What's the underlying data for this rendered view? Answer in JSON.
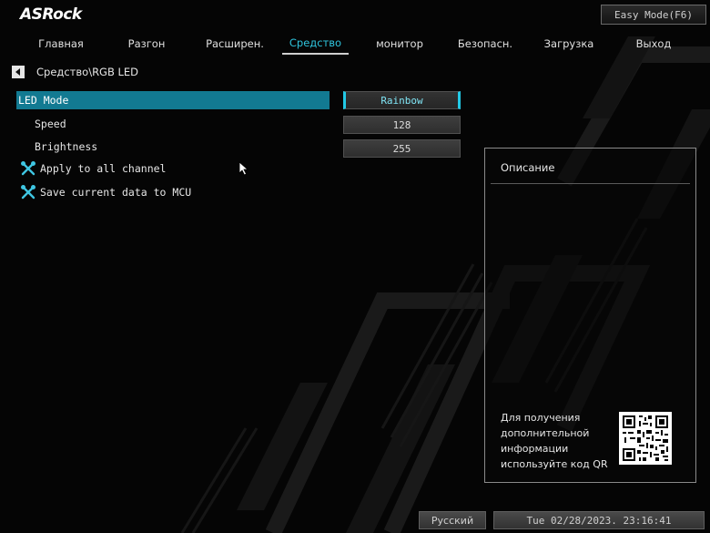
{
  "brand": {
    "logo": "ASRock"
  },
  "header": {
    "easy_mode_label": "Easy Mode(F6)"
  },
  "tabs": [
    {
      "label": "Главная"
    },
    {
      "label": "Разгон"
    },
    {
      "label": "Расширен."
    },
    {
      "label": "Средство",
      "active": true
    },
    {
      "label": "монитор"
    },
    {
      "label": "Безопасн."
    },
    {
      "label": "Загрузка"
    },
    {
      "label": "Выход"
    }
  ],
  "breadcrumb": "Средство\\RGB LED",
  "settings": [
    {
      "label": "LED Mode",
      "value": "Rainbow",
      "selected": true
    },
    {
      "label": "Speed",
      "value": "128"
    },
    {
      "label": "Brightness",
      "value": "255"
    }
  ],
  "actions": [
    {
      "label": "Apply to all channel",
      "icon": "tools-icon"
    },
    {
      "label": "Save current data to MCU",
      "icon": "tools-icon"
    }
  ],
  "description": {
    "title": "Описание",
    "note": "Для получения дополнительной информации используйте код QR"
  },
  "footer": {
    "language": "Русский",
    "datetime": "Tue 02/28/2023. 23:16:41"
  },
  "colors": {
    "accent": "#2fc4dd",
    "selected_row": "#127a92",
    "background": "#050505"
  }
}
